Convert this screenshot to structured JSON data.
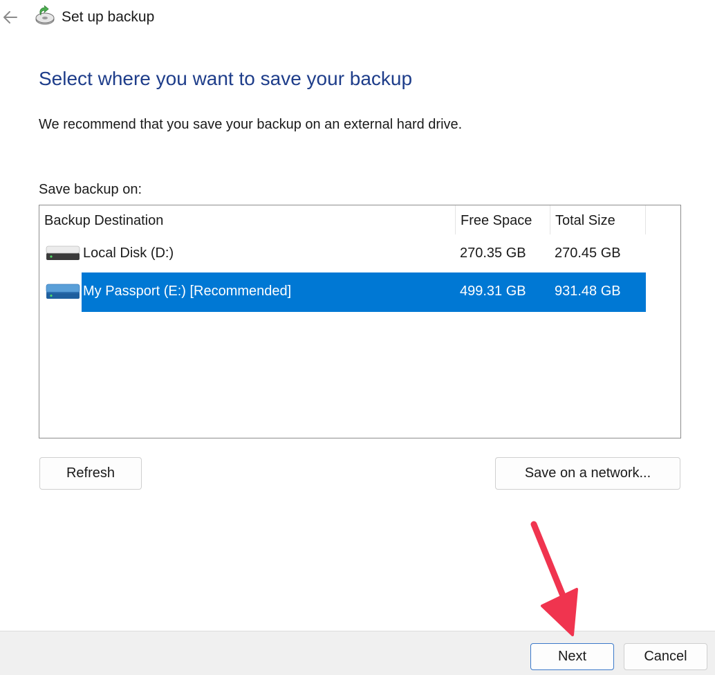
{
  "window": {
    "title": "Set up backup",
    "back_icon": "back-arrow-icon",
    "app_icon": "backup-icon"
  },
  "page": {
    "heading": "Select where you want to save your backup",
    "recommendation": "We recommend that you save your backup on an external hard drive.",
    "save_on_label": "Save backup on:"
  },
  "table": {
    "columns": [
      "Backup Destination",
      "Free Space",
      "Total Size"
    ],
    "rows": [
      {
        "icon": "drive-icon",
        "name": "Local Disk (D:)",
        "free": "270.35 GB",
        "total": "270.45 GB",
        "selected": false
      },
      {
        "icon": "external-drive-icon",
        "name": "My Passport (E:) [Recommended]",
        "free": "499.31 GB",
        "total": "931.48 GB",
        "selected": true
      }
    ]
  },
  "buttons": {
    "refresh": "Refresh",
    "save_network": "Save on a network...",
    "next": "Next",
    "cancel": "Cancel"
  },
  "colors": {
    "heading": "#1e3d8a",
    "selection": "#0078d4",
    "annotation_arrow": "#f0344f"
  },
  "annotation": {
    "icon": "red-arrow-icon"
  }
}
